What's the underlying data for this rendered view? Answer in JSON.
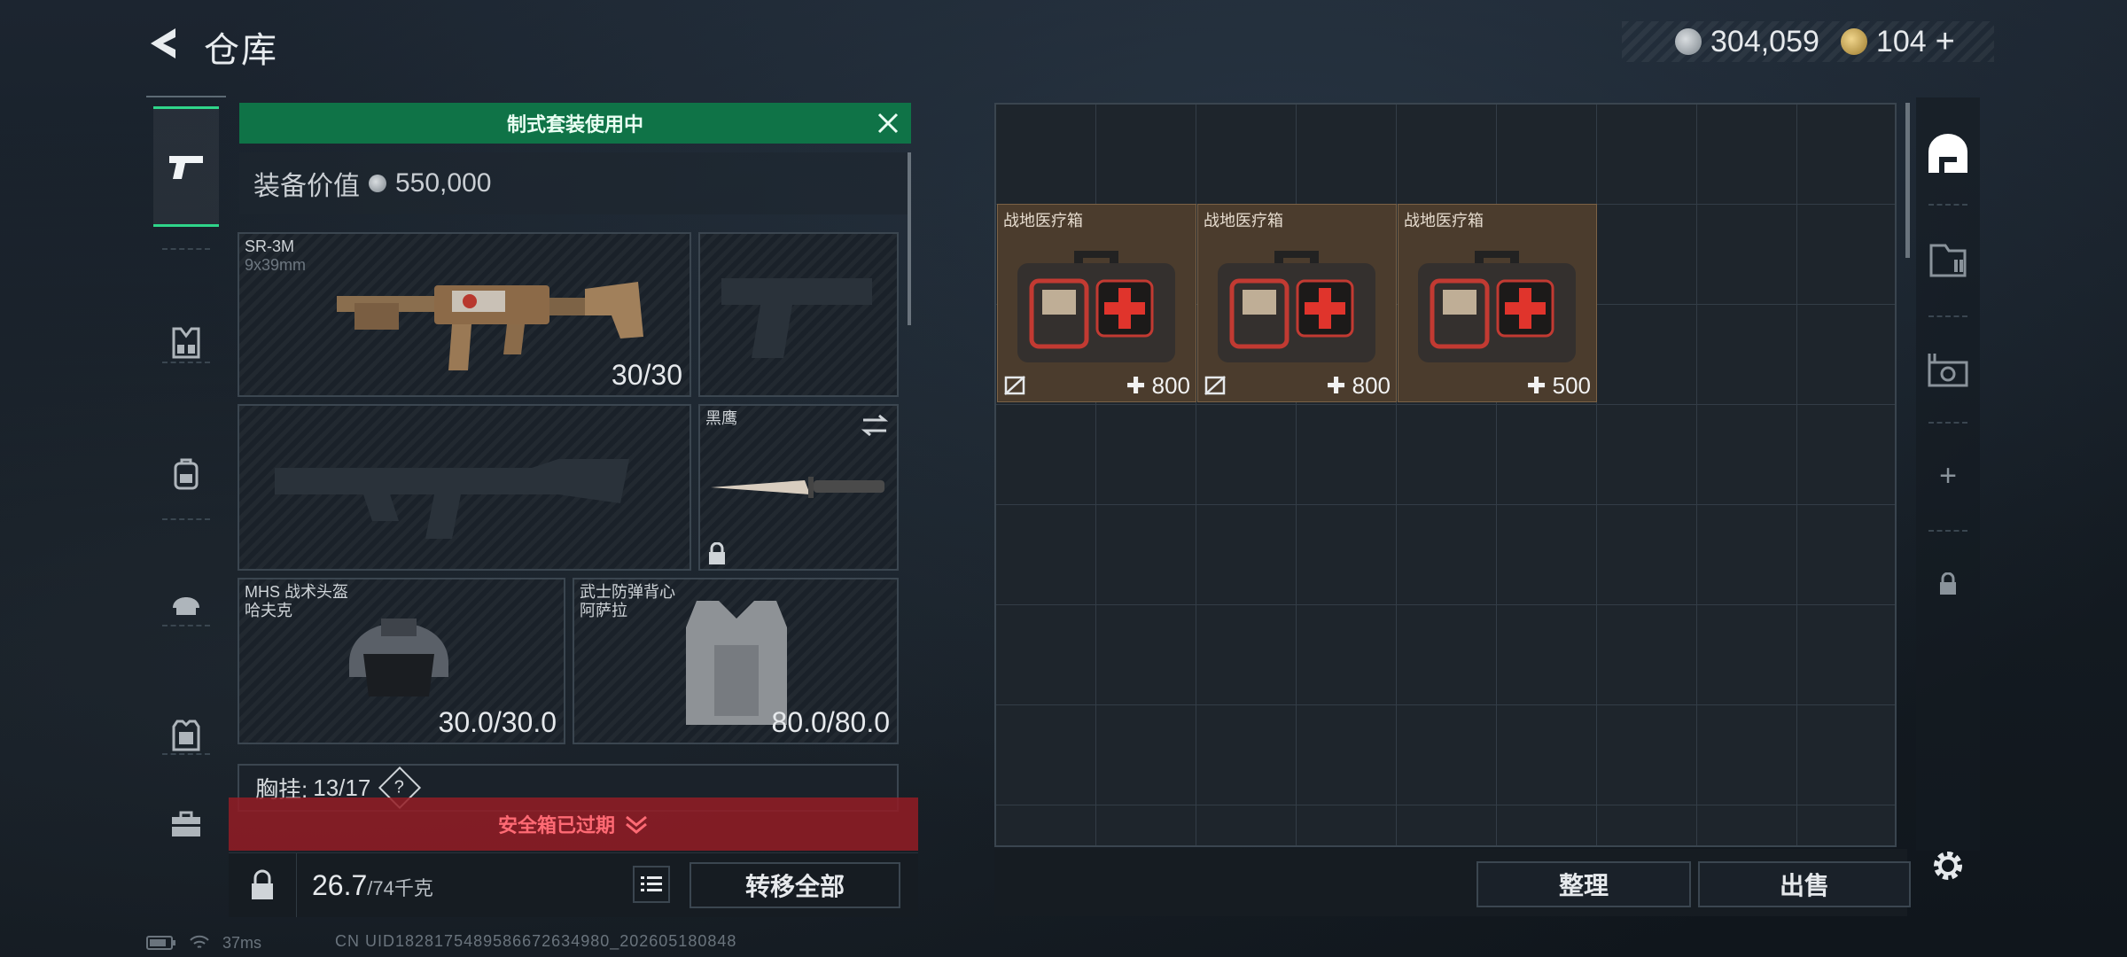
{
  "header": {
    "title": "仓库",
    "currency_a": "304,059",
    "currency_b": "104",
    "add_label": "+"
  },
  "loadout": {
    "kit_banner": "制式套装使用中",
    "value_label": "装备价值",
    "value": "550,000",
    "primary": {
      "name": "SR-3M",
      "caliber": "9x39mm",
      "ammo": "30/30"
    },
    "melee": {
      "name": "黑鹰"
    },
    "helmet": {
      "name": "MHS 战术头盔",
      "brand": "哈夫克",
      "durability": "30.0/30.0"
    },
    "armor": {
      "name": "武士防弹背心",
      "brand": "阿萨拉",
      "durability": "80.0/80.0"
    },
    "chest_label": "胸挂:",
    "chest_value": "13/17",
    "chest_help": "?",
    "safebox_text": "安全箱已过期",
    "weight": "26.7",
    "weight_max": "/74千克",
    "transfer_label": "转移全部"
  },
  "storage": {
    "items": [
      {
        "name": "战地医疗箱",
        "heal": "800"
      },
      {
        "name": "战地医疗箱",
        "heal": "800"
      },
      {
        "name": "战地医疗箱",
        "heal": "500"
      }
    ],
    "sort_label": "整理",
    "sell_label": "出售",
    "side_plus": "+"
  },
  "status": {
    "ping": "37ms",
    "uid": "CN UID1828175489586672634980_202605180848"
  },
  "colors": {
    "accent_green": "#0f7347",
    "active_green": "#2fd58a",
    "warning_red": "#941c24",
    "item_brown": "#4b3c2d"
  },
  "icons": [
    "back-icon",
    "pistol-icon",
    "chest-rig-icon",
    "backpack-icon",
    "helmet-icon",
    "armor-vest-icon",
    "toolbox-icon",
    "safehouse-icon",
    "storage-icon",
    "cash-register-icon",
    "plus-icon",
    "lock-icon",
    "gear-icon",
    "list-icon",
    "close-icon"
  ]
}
